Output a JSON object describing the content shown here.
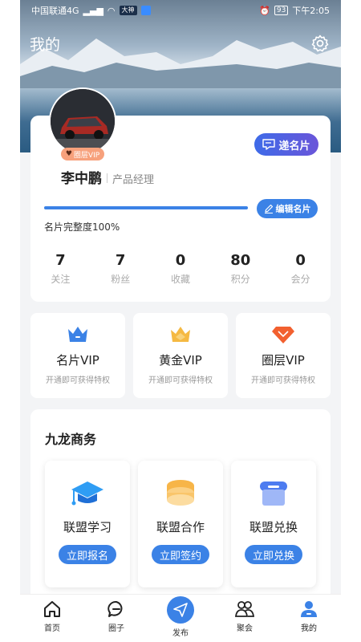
{
  "status_bar": {
    "carrier": "中国联通4G",
    "app_badge": "大神",
    "battery": "93",
    "time": "下午2:05"
  },
  "header": {
    "title": "我的"
  },
  "profile": {
    "vip_tag": "圈层VIP",
    "card_button": "递名片",
    "name": "李中鹏",
    "title": "产品经理",
    "edit_button": "编辑名片",
    "completeness_text": "名片完整度100%",
    "completeness_fraction": 1.0,
    "stats": [
      {
        "value": "7",
        "label": "关注"
      },
      {
        "value": "7",
        "label": "粉丝"
      },
      {
        "value": "0",
        "label": "收藏"
      },
      {
        "value": "80",
        "label": "积分"
      },
      {
        "value": "0",
        "label": "会分"
      }
    ]
  },
  "vip_cards": [
    {
      "name": "名片VIP",
      "desc": "开通即可获得特权",
      "icon": "blue-crown-icon",
      "color": "#3b82e6"
    },
    {
      "name": "黄金VIP",
      "desc": "开通即可获得特权",
      "icon": "gold-crown-icon",
      "color": "#f5b942"
    },
    {
      "name": "圈层VIP",
      "desc": "开通即可获得特权",
      "icon": "diamond-icon",
      "color": "#f2602f"
    }
  ],
  "business": {
    "title": "九龙商务",
    "items": [
      {
        "name": "联盟学习",
        "button": "立即报名",
        "icon": "graduation-cap-icon"
      },
      {
        "name": "联盟合作",
        "button": "立即签约",
        "icon": "coin-stack-icon"
      },
      {
        "name": "联盟兑换",
        "button": "立即兑换",
        "icon": "shop-icon"
      }
    ]
  },
  "bottom_nav": [
    {
      "label": "首页",
      "icon": "home-icon"
    },
    {
      "label": "圈子",
      "icon": "chat-bubble-icon"
    },
    {
      "label": "发布",
      "icon": "send-icon"
    },
    {
      "label": "聚会",
      "icon": "group-icon"
    },
    {
      "label": "我的",
      "icon": "user-icon"
    }
  ],
  "colors": {
    "accent": "#3b82e6",
    "vip_tag": "#f7a17c",
    "card_button_gradient": [
      "#3e6be8",
      "#6a55d9"
    ]
  }
}
